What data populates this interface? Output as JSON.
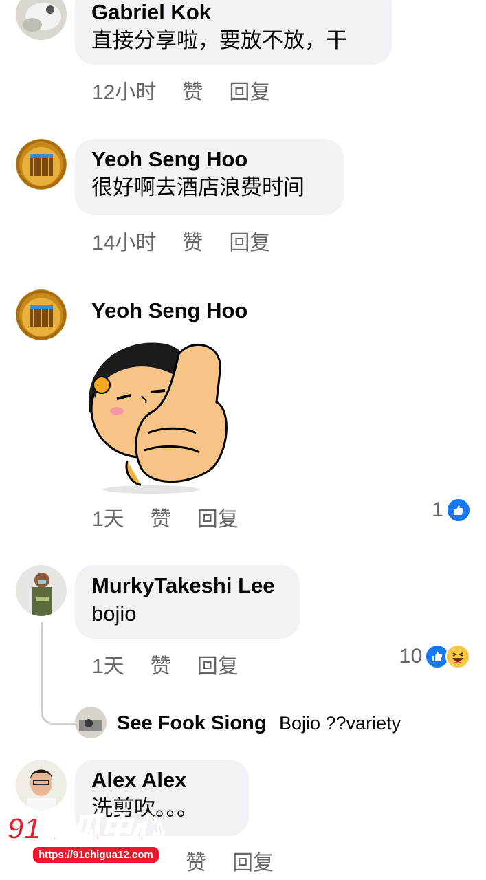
{
  "comments": [
    {
      "author": "Gabriel Kok",
      "text": "直接分享啦，要放不放，干",
      "time": "12小时",
      "like": "赞",
      "reply": "回复"
    },
    {
      "author": "Yeoh Seng Hoo",
      "text": "很好啊去酒店浪费时间",
      "time": "14小时",
      "like": "赞",
      "reply": "回复"
    },
    {
      "author": "Yeoh Seng Hoo",
      "sticker": "thumbs-up-cartoon-sticker",
      "time": "1天",
      "like": "赞",
      "reply": "回复",
      "reaction_count": "1"
    },
    {
      "author": "MurkyTakeshi Lee",
      "text": "bojio",
      "time": "1天",
      "like": "赞",
      "reply": "回复",
      "reaction_count": "10",
      "reply_preview": {
        "author": "See Fook  Siong",
        "text": "Bojio ??variety"
      }
    },
    {
      "author": "Alex Alex",
      "text": "洗剪吹。。。",
      "time": "",
      "like": "赞",
      "reply": "回复"
    }
  ],
  "watermark": {
    "logo_text": "91吃瓜中心",
    "url": "https://91chigua12.com"
  },
  "colors": {
    "bubble": "#f0f2f5",
    "meta": "#65676b",
    "like_blue": "#1877f2",
    "haha_yellow": "#f7c844",
    "watermark_red": "#e8192c"
  }
}
